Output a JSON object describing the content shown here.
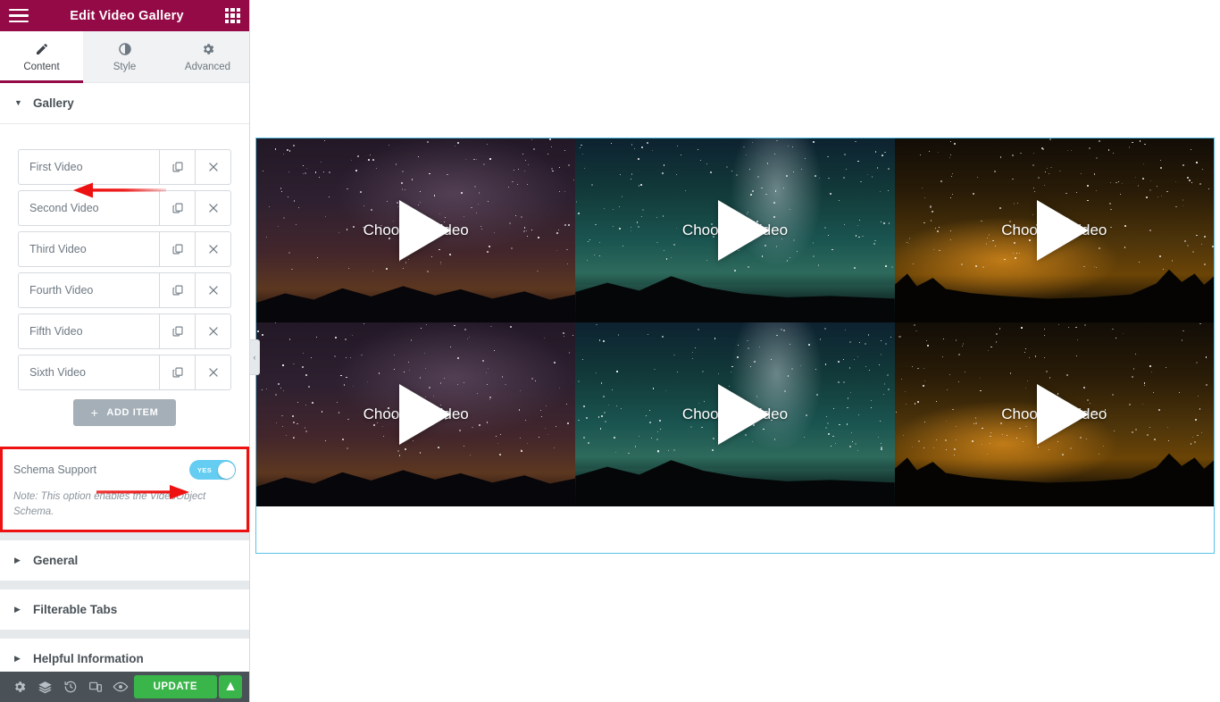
{
  "panel": {
    "header": {
      "title": "Edit Video Gallery",
      "menu_icon": "hamburger-menu-icon",
      "apps_icon": "apps-grid-icon"
    },
    "tabs": [
      {
        "label": "Content",
        "icon": "pencil-icon",
        "active": true
      },
      {
        "label": "Style",
        "icon": "contrast-circle-icon",
        "active": false
      },
      {
        "label": "Advanced",
        "icon": "gear-icon",
        "active": false
      }
    ],
    "sections": [
      {
        "id": "gallery",
        "title": "Gallery",
        "expanded": true
      },
      {
        "id": "general",
        "title": "General",
        "expanded": false
      },
      {
        "id": "tabs",
        "title": "Filterable Tabs",
        "expanded": false
      },
      {
        "id": "helpful",
        "title": "Helpful Information",
        "expanded": false
      }
    ],
    "repeater": {
      "items": [
        {
          "label": "First Video"
        },
        {
          "label": "Second Video"
        },
        {
          "label": "Third Video"
        },
        {
          "label": "Fourth Video"
        },
        {
          "label": "Fifth Video"
        },
        {
          "label": "Sixth Video"
        }
      ],
      "duplicate_icon": "duplicate-icon",
      "remove_icon": "close-x-icon",
      "add_item_label": "ADD ITEM",
      "add_item_plus": "+"
    },
    "schema": {
      "label": "Schema Support",
      "toggle_value": "YES",
      "toggle_on": true,
      "note": "Note: This option enables the VideoObject Schema."
    },
    "footer": {
      "icons": [
        {
          "name": "settings-gear-icon"
        },
        {
          "name": "navigator-layers-icon"
        },
        {
          "name": "history-clock-icon"
        },
        {
          "name": "responsive-mode-icon"
        },
        {
          "name": "preview-eye-icon"
        }
      ],
      "update_label": "UPDATE",
      "update_caret": "▲"
    },
    "collapse_handle": "‹"
  },
  "annotations": {
    "arrow_color": "#ee1111",
    "highlight_color": "#ee1111",
    "arrows": [
      {
        "target": "gallery-section-title"
      },
      {
        "target": "schema-support-toggle"
      }
    ]
  },
  "canvas": {
    "widget_border_color": "#59c3e8",
    "videos": [
      {
        "label": "Choose a video",
        "theme": "purple",
        "play_icon": "play-triangle-icon"
      },
      {
        "label": "Choose a video",
        "theme": "teal",
        "play_icon": "play-triangle-icon"
      },
      {
        "label": "Choose a video",
        "theme": "amber",
        "play_icon": "play-triangle-icon"
      },
      {
        "label": "Choose a video",
        "theme": "purple",
        "play_icon": "play-triangle-icon"
      },
      {
        "label": "Choose a video",
        "theme": "teal",
        "play_icon": "play-triangle-icon"
      },
      {
        "label": "Choose a video",
        "theme": "amber",
        "play_icon": "play-triangle-icon"
      }
    ]
  }
}
